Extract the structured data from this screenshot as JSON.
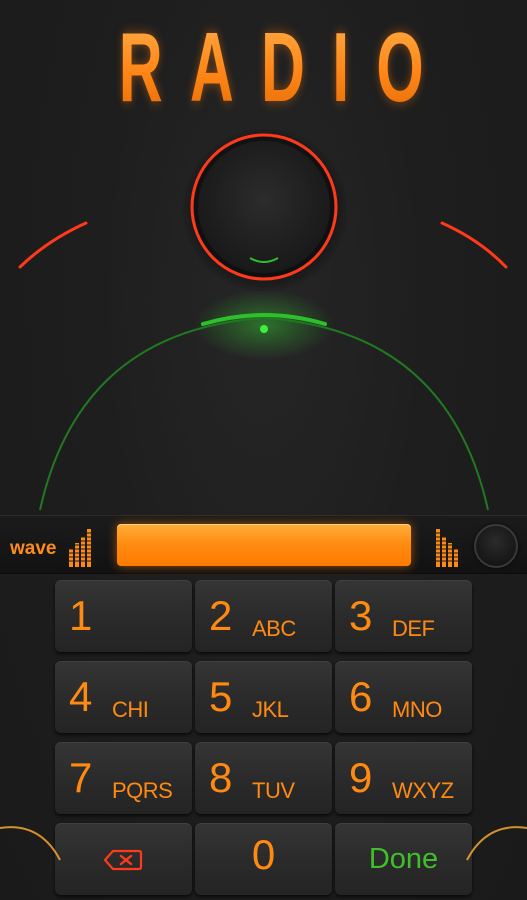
{
  "app": {
    "title": "RADIO"
  },
  "wave_bar": {
    "label": "wave"
  },
  "keypad": {
    "keys": [
      {
        "digit": "1",
        "letters": ""
      },
      {
        "digit": "2",
        "letters": "ABC"
      },
      {
        "digit": "3",
        "letters": "DEF"
      },
      {
        "digit": "4",
        "letters": "CHI"
      },
      {
        "digit": "5",
        "letters": "JKL"
      },
      {
        "digit": "6",
        "letters": "MNO"
      },
      {
        "digit": "7",
        "letters": "PQRS"
      },
      {
        "digit": "8",
        "letters": "TUV"
      },
      {
        "digit": "9",
        "letters": "WXYZ"
      }
    ],
    "zero": "0",
    "done_label": "Done",
    "backspace_icon": "backspace-icon"
  },
  "colors": {
    "accent_orange": "#ff8a12",
    "ring_red": "#ff3a1a",
    "ring_green": "#2ec02a",
    "done_green": "#3fbf2a",
    "background": "#1e1e1e"
  }
}
